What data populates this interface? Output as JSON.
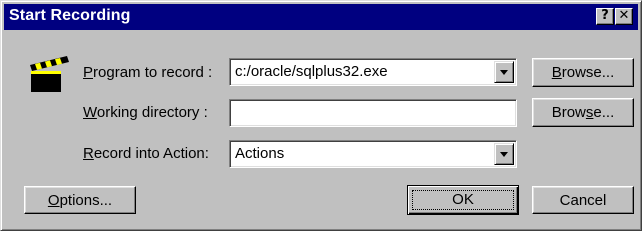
{
  "window": {
    "title": "Start Recording",
    "help_glyph": "?",
    "close_glyph": "✕"
  },
  "icon": {
    "name": "clapperboard-icon"
  },
  "program": {
    "label_u": "P",
    "label_rest": "rogram to record :",
    "value": "c:/oracle/sqlplus32.exe",
    "browse_u": "B",
    "browse_rest": "rowse..."
  },
  "workdir": {
    "label_u": "W",
    "label_rest": "orking directory :",
    "value": "",
    "browse_a": "Brow",
    "browse_u": "s",
    "browse_b": "e..."
  },
  "record": {
    "label_u": "R",
    "label_rest": "ecord into Action:",
    "value": "Actions"
  },
  "buttons": {
    "options_u": "O",
    "options_rest": "ptions...",
    "ok": "OK",
    "cancel": "Cancel"
  },
  "colors": {
    "titlebar": "#000080",
    "face": "#c0c0c0"
  }
}
